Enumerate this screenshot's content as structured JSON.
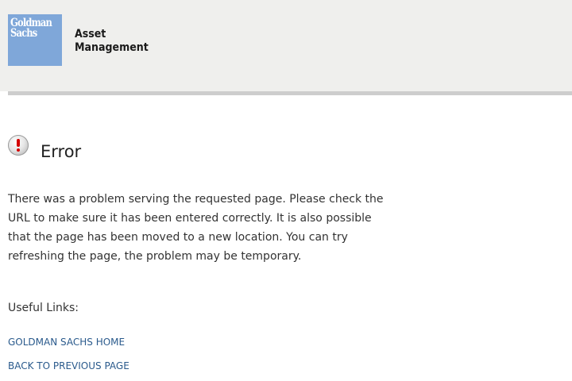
{
  "header": {
    "logo": {
      "line1": "Goldman",
      "line2": "Sachs",
      "color": "#7fa7d9"
    },
    "division": {
      "line1": "Asset",
      "line2": "Management"
    }
  },
  "error": {
    "icon": "exclamation-icon",
    "title": "Error",
    "message": "There was a problem serving the requested page. Please check the URL to make sure it has been entered correctly. It is also possible that the page has been moved to a new location. You can try refreshing the page, the problem may be temporary."
  },
  "useful_links": {
    "label": "Useful Links:",
    "items": [
      {
        "label": "GOLDMAN SACHS HOME"
      },
      {
        "label": "BACK TO PREVIOUS PAGE"
      }
    ],
    "link_color": "#2a5a8c"
  }
}
